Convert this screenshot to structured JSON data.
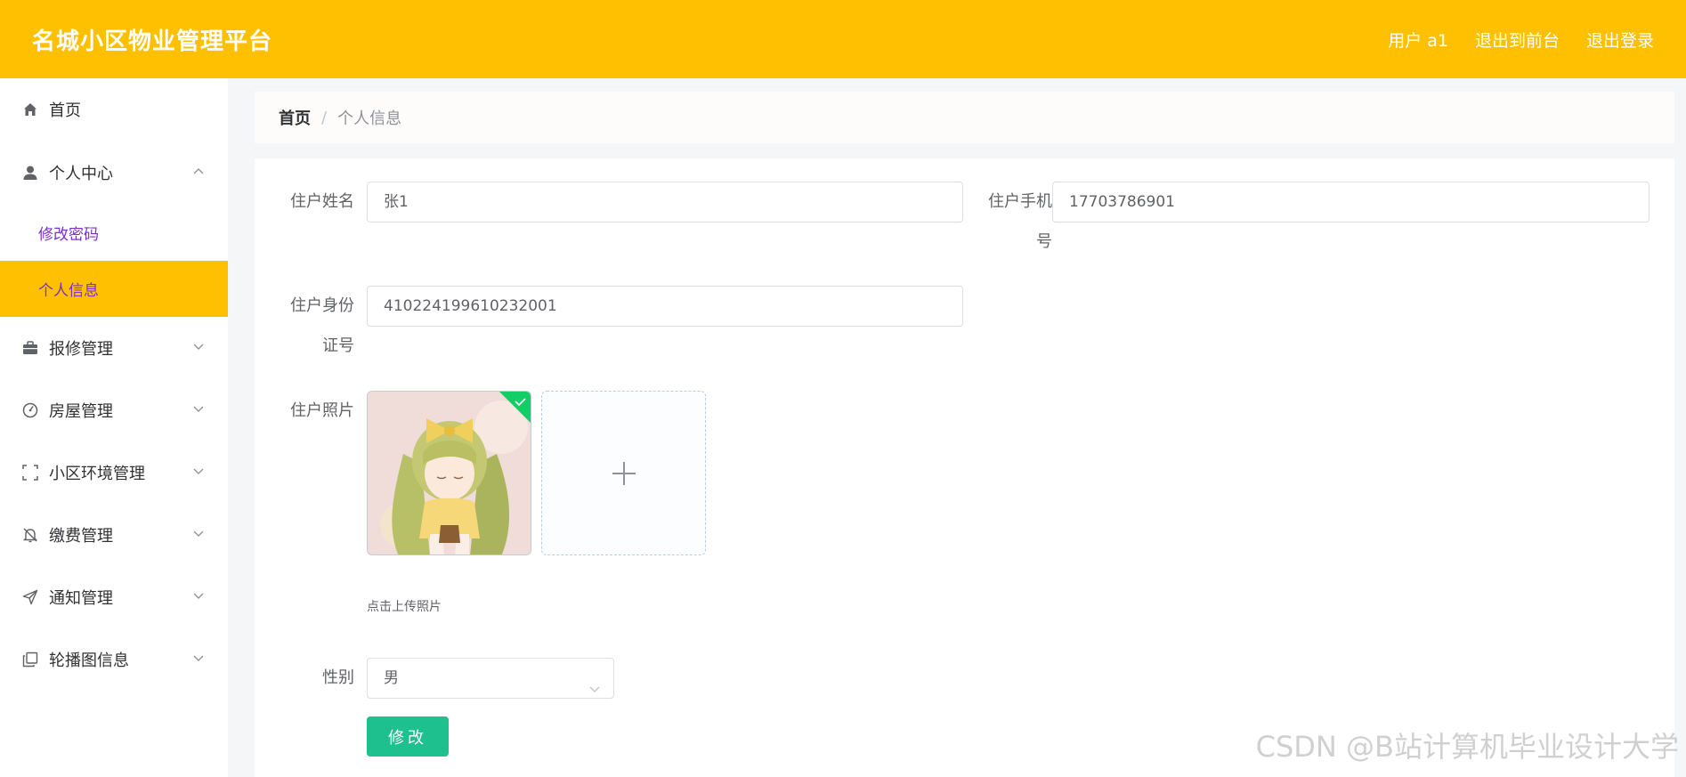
{
  "header": {
    "title": "名城小区物业管理平台",
    "user_label": "用户 a1",
    "front_link": "退出到前台",
    "logout_link": "退出登录",
    "bg_color": "#fec000"
  },
  "sidebar": {
    "items": [
      {
        "label": "首页",
        "icon": "home-icon"
      },
      {
        "label": "个人中心",
        "icon": "user-icon",
        "expanded": true,
        "children": [
          {
            "label": "修改密码"
          },
          {
            "label": "个人信息",
            "active": true
          }
        ]
      },
      {
        "label": "报修管理",
        "icon": "briefcase-icon"
      },
      {
        "label": "房屋管理",
        "icon": "gauge-icon"
      },
      {
        "label": "小区环境管理",
        "icon": "fullscreen-icon"
      },
      {
        "label": "缴费管理",
        "icon": "bell-off-icon"
      },
      {
        "label": "通知管理",
        "icon": "send-icon"
      },
      {
        "label": "轮播图信息",
        "icon": "copy-icon"
      }
    ]
  },
  "breadcrumb": {
    "home": "首页",
    "separator": "/",
    "current": "个人信息"
  },
  "form": {
    "name_label": "住户姓名",
    "name_value": "张1",
    "phone_label_line1": "住户手机",
    "phone_label_line2": "号",
    "phone_value": "17703786901",
    "idcard_label_line1": "住户身份",
    "idcard_label_line2": "证号",
    "idcard_value": "410224199610232001",
    "photo_label": "住户照片",
    "photo_tip": "点击上传照片",
    "gender_label": "性别",
    "gender_value": "男",
    "submit_label": "修改",
    "accent_color": "#1ec08e"
  },
  "watermark": "CSDN @B站计算机毕业设计大学"
}
